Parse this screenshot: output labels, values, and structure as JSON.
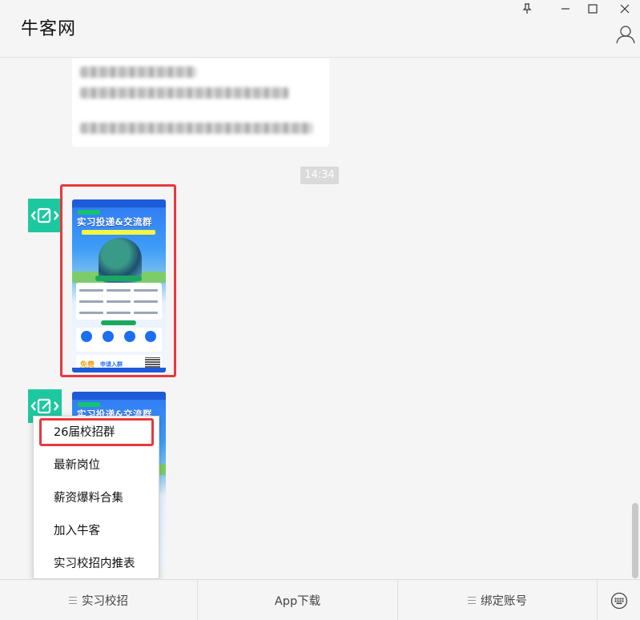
{
  "app": {
    "title": "牛客网"
  },
  "chat": {
    "timestamp": "14:34"
  },
  "poster": {
    "title": "实习投递&交流群",
    "free_label": "免费",
    "apply_label": "申请入群"
  },
  "menu": {
    "items": [
      {
        "label": "26届校招群"
      },
      {
        "label": "最新岗位"
      },
      {
        "label": "薪资爆料合集"
      },
      {
        "label": "加入牛客"
      },
      {
        "label": "实习校招内推表"
      }
    ]
  },
  "bottom_tabs": [
    {
      "label": "实习校招"
    },
    {
      "label": "App下载"
    },
    {
      "label": "绑定账号"
    }
  ],
  "colors": {
    "highlight": "#e8383d",
    "avatar": "#1dc8a0",
    "poster_blue": "#2f77f3"
  }
}
